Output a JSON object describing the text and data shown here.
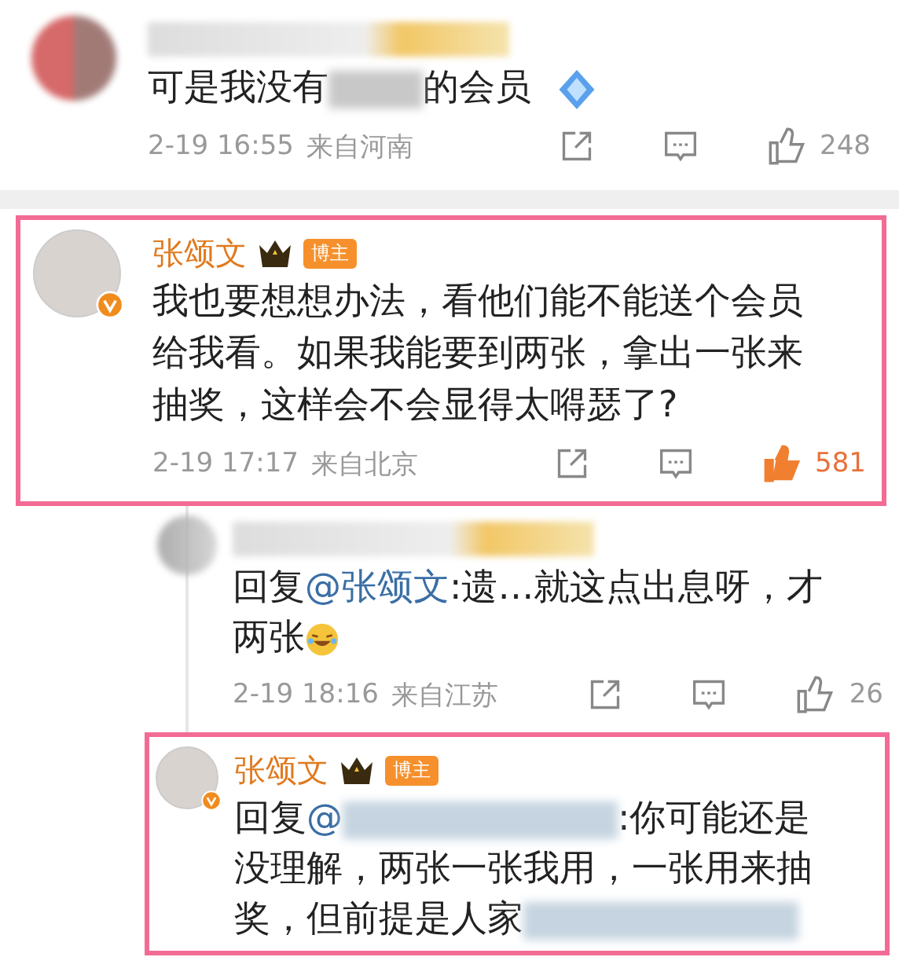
{
  "comments": [
    {
      "kind": "top",
      "avatar_blurred": true,
      "highlighted": false,
      "sticker": true,
      "parts": [
        {
          "kind": "text",
          "text": "可是我没有"
        },
        {
          "kind": "blur"
        },
        {
          "kind": "text",
          "text": "的会员"
        }
      ],
      "time": "2-19 16:55",
      "location": "来自河南",
      "likes": "248",
      "liked": false
    },
    {
      "kind": "top",
      "avatar_blurred": false,
      "author": "张颂文",
      "verified": true,
      "badge": "博主",
      "highlighted": true,
      "parts": [
        {
          "kind": "text",
          "text": "我也要想想办法，看他们能不能送个会员给我看。如果我能要到两张，拿出一张来抽奖，这样会不会显得太嘚瑟了?"
        }
      ],
      "time": "2-19 17:17",
      "location": "来自北京",
      "likes": "581",
      "liked": true
    },
    {
      "kind": "reply",
      "avatar_blurred": true,
      "highlighted": false,
      "parts": [
        {
          "kind": "text",
          "text": "回复"
        },
        {
          "kind": "mention",
          "text": "@张颂文"
        },
        {
          "kind": "text",
          "text": ":遗…就这点出息呀，才两张"
        },
        {
          "kind": "emoji"
        }
      ],
      "time": "2-19 18:16",
      "location": "来自江苏",
      "likes": "26",
      "liked": false
    },
    {
      "kind": "reply",
      "avatar_blurred": false,
      "author": "张颂文",
      "verified": true,
      "badge": "博主",
      "highlighted": true,
      "parts": [
        {
          "kind": "text",
          "text": "回复"
        },
        {
          "kind": "mention",
          "text": "@"
        },
        {
          "kind": "blur"
        },
        {
          "kind": "text",
          "text": ":你可能还是没理解，两张一张我用，一张用来抽奖，但前提是人家"
        },
        {
          "kind": "blur"
        }
      ]
    }
  ]
}
